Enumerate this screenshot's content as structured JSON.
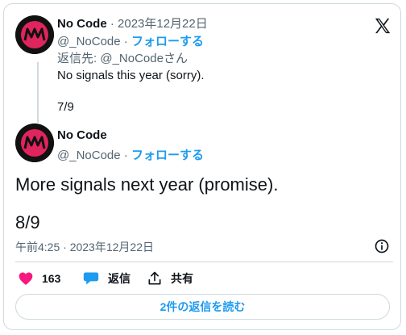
{
  "reply_tweet": {
    "display_name": "No Code",
    "date": "· 2023年12月22日",
    "handle": "@_NoCode",
    "separator": " · ",
    "follow_label": "フォローする",
    "replying_prefix": "返信先: ",
    "replying_handle": "@_NoCode",
    "replying_suffix": "さん",
    "text_line1": "No signals this year (sorry).",
    "text_line2": "7/9"
  },
  "main_tweet": {
    "display_name": "No Code",
    "handle": "@_NoCode",
    "separator": " · ",
    "follow_label": "フォローする",
    "text_line1": "More signals next year (promise).",
    "text_line2": "8/9",
    "timestamp": "午前4:25 · 2023年12月22日"
  },
  "actions": {
    "like_count": "163",
    "reply_label": "返信",
    "share_label": "共有"
  },
  "replies_button": "2件の返信を読む",
  "icons": {
    "brand": "x-logo-icon",
    "info": "info-icon",
    "like": "heart-icon",
    "reply": "speech-bubble-icon",
    "share": "share-icon"
  },
  "colors": {
    "accent": "#1d9bf0",
    "like": "#f91880",
    "muted": "#536471",
    "avatar_red": "#e0245e"
  }
}
